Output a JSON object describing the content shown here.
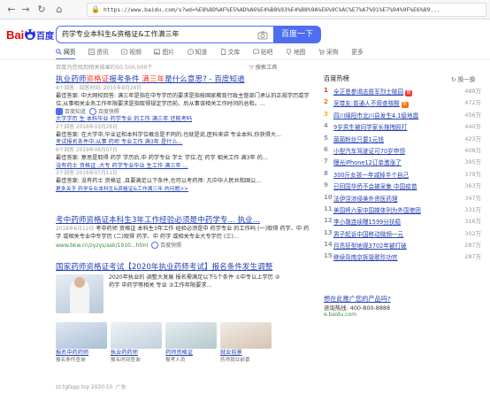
{
  "browser": {
    "url": "https://www.baidu.com/s?wd=%E8%8D%AF%E5%AD%A6%E4%B8%93%E4%B8%9A%E6%9C%AC%E7%A7%91%E7%94%9F%E6%89..."
  },
  "header": {
    "logo_text": "Bai百度",
    "search_value": "药学专业本科生&资格证&工作满三年",
    "search_button": "百度一下"
  },
  "tabs": [
    {
      "label": "网页",
      "icon": "search-icon"
    },
    {
      "label": "资讯",
      "icon": "news-icon"
    },
    {
      "label": "视频",
      "icon": "video-icon"
    },
    {
      "label": "图片",
      "icon": "image-icon"
    },
    {
      "label": "知道",
      "icon": "question-icon"
    },
    {
      "label": "文库",
      "icon": "doc-icon"
    },
    {
      "label": "贴吧",
      "icon": "forum-icon"
    },
    {
      "label": "地图",
      "icon": "map-icon"
    },
    {
      "label": "采购",
      "icon": "cart-icon"
    },
    {
      "label": "更多",
      "icon": ""
    }
  ],
  "result_count": "百度为您找到相关结果约50,500,000个",
  "search_tools": "搜索工具",
  "results": {
    "r1": {
      "title_pre": "执业药师",
      "title_em": "资格证",
      "title_mid": "报考条件 ",
      "title_em2": "满三年",
      "title_post": "是什么意思? - 百度知道",
      "meta": "4个回答 - 回答时间: 2015年8月24日",
      "text": "最佳答案: 中大网校回答: 满三年是指在中专学历的要求是指按国家教育行政主管部门承认的正规学历或学位,从事相关业务工作年限要求是指取得规定学历前、后从事该相关工作时间的总和。...",
      "source": "百度知道",
      "source2": "百度快照",
      "sub1": "大学学历 生 本科毕业 药学专业 的工作 满三年 还能考吗",
      "sub1_meta": "2个回答 2018年03月28日",
      "sub1_text": "最佳答案: 在大学中,毕业证和本科学位概念是不同的,也就是说,医科来讲 专业本科,你获得大...",
      "sub2": "考试报名条件中,从事 药师 专业工作 满3年 是什么...",
      "sub2_meta": "6个回答 2019年08月07日",
      "sub2_text": "最佳答案: 意思是取得 药学 学历后,中 药学专业 学士 学位,在 药学 相关工作 满3年 的...",
      "sub3": "没有药士 资格证 ,大专 药学专业毕业 生工作 满三年 ...",
      "sub3_meta": "3个回答 2016年07月11日",
      "sub3_text": "最佳答案: 没有药士 资格证 ,且要满足以下条件,也可以考药师: 凡中华人民共和国公...",
      "more": "更多关于 药学专业本科生&资格证&工作满三年 的问题>>"
    },
    "r2": {
      "title": "考中药师资格证本科生3年工作经验必须是中药学专... 执业...",
      "meta": "2018年6月12日",
      "text": "考中药师 资格证 本科生3年工作 经验必须是中 药学专业 的工作吗 (一)取得 药学、中 药学 或相关专业中专学历 (二)取得 药学、中 药学 或相关专业大专学历 (三)...",
      "url": "www.bkw.cn/zyzys/ask/1910...html",
      "snapshot": "百度快照"
    },
    "r3": {
      "title": "国家药师资格证考试【2020年执业药师考试】报名条件发生调整",
      "text1": "2020年执业的 调整大发展 报名需满足以下5个条件 ①中专以上学历 ②",
      "text2": "药学 中药学等相关 专业 ③工作年限要求...",
      "links": [
        {
          "cap": "报名中药药师",
          "sub": "报名条件查询"
        },
        {
          "cap": "执业药药师",
          "sub": "报名时间查询"
        },
        {
          "cap": "药师资格证",
          "sub": "报考人员"
        },
        {
          "cap": "就业前景",
          "sub": "药师就业前景"
        }
      ],
      "ad_url": "zz.tgfapp.top 2020-10",
      "ad_tag": "广告"
    }
  },
  "hot": {
    "title": "百度热榜",
    "refresh": "换一换",
    "items": [
      {
        "rank": "1",
        "text": "全正恩参谒志愿军烈士陵园",
        "tag": "热",
        "count": "489万"
      },
      {
        "rank": "2",
        "text": "吴尊友:普通人不用查核酸",
        "tag": "新",
        "count": "472万"
      },
      {
        "rank": "3",
        "text": "四川绵阳市北川县发生4.1级地震",
        "tag": "",
        "count": "456万"
      },
      {
        "rank": "4",
        "text": "9岁男生被同学家长拖拽殴打",
        "tag": "",
        "count": "440万"
      },
      {
        "rank": "5",
        "text": "菌菌粉丝只要1元钱",
        "tag": "",
        "count": "423万"
      },
      {
        "rank": "6",
        "text": "小型汽车驾驶证可70岁申领",
        "tag": "",
        "count": "408万"
      },
      {
        "rank": "7",
        "text": "曝光iPhone12订单激涨了",
        "tag": "",
        "count": "395万"
      },
      {
        "rank": "8",
        "text": "300斤女孩一年减掉半个自己",
        "tag": "",
        "count": "379万"
      },
      {
        "rank": "9",
        "text": "已回国华侨不会被采集 中国疫苗",
        "tag": "",
        "count": "363万"
      },
      {
        "rank": "10",
        "text": "法伊涅涉侵美外资医药理",
        "tag": "",
        "count": "347万"
      },
      {
        "rank": "11",
        "text": "美国将六家中国媒体列为外国使团",
        "tag": "",
        "count": "331万"
      },
      {
        "rank": "12",
        "text": "李小璐连续曝1599分扶稳",
        "tag": "",
        "count": "316万"
      },
      {
        "rank": "13",
        "text": "男子起诉中国移动微频一元",
        "tag": "",
        "count": "302万"
      },
      {
        "rank": "14",
        "text": "月亮狂型地观3702年被打破",
        "tag": "",
        "count": "287万"
      },
      {
        "rank": "15",
        "text": "继续背南京拆毁歌珍功宫",
        "tag": "",
        "count": "287万"
      }
    ]
  },
  "side_ad": {
    "question": "想在此推广您的产品吗?",
    "tel": "咨询热线: 400-800-8888",
    "site": "e.baidu.com"
  },
  "colors": {
    "brand_blue": "#4e6ef2",
    "link_blue": "#2440b3",
    "red_em": "#f73131",
    "rank_red": "#f73131",
    "rank_orange": "#ff6600",
    "rank_yellow": "#faa90e",
    "tag_hot": "#f73131",
    "tag_new": "#ff6600"
  }
}
